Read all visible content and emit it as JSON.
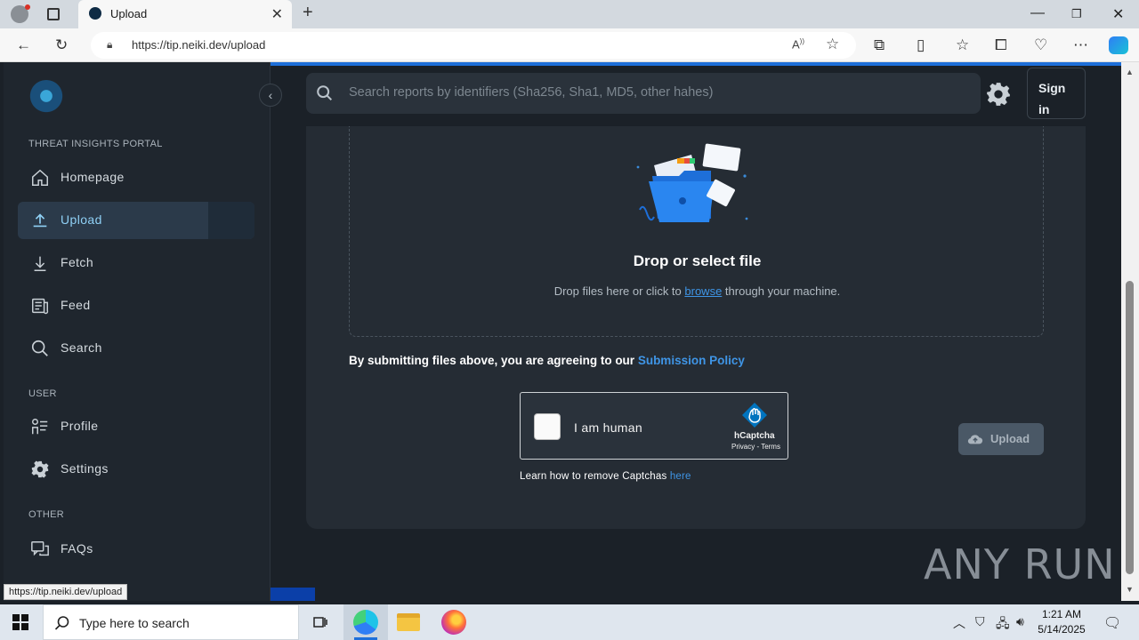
{
  "browser": {
    "tab_title": "Upload",
    "url_full": "https://tip.neiki.dev/upload",
    "url_prefix": "https://",
    "url_host": "tip.neiki.dev",
    "url_path": "/upload",
    "status_url": "https://tip.neiki.dev/upload"
  },
  "sidebar": {
    "portal_label": "THREAT INSIGHTS PORTAL",
    "user_label": "USER",
    "other_label": "OTHER",
    "items": [
      {
        "label": "Homepage",
        "icon": "home-icon"
      },
      {
        "label": "Upload",
        "icon": "upload-icon",
        "active": true
      },
      {
        "label": "Fetch",
        "icon": "download-icon"
      },
      {
        "label": "Feed",
        "icon": "feed-icon"
      },
      {
        "label": "Search",
        "icon": "search-icon"
      },
      {
        "label": "Profile",
        "icon": "profile-icon"
      },
      {
        "label": "Settings",
        "icon": "gear-icon"
      },
      {
        "label": "FAQs",
        "icon": "faq-icon"
      }
    ]
  },
  "header": {
    "search_placeholder": "Search reports by identifiers (Sha256, Sha1, MD5, other hahes)",
    "signin_label": "Sign in"
  },
  "upload": {
    "drop_title": "Drop or select file",
    "drop_sub_before": "Drop files here or click to ",
    "drop_sub_link": "browse",
    "drop_sub_after": " through your machine.",
    "agree_text": "By submitting files above, you are agreeing to our ",
    "agree_link": "Submission Policy",
    "captcha_label": "I am human",
    "captcha_brand": "hCaptcha",
    "captcha_links": "Privacy - Terms",
    "learn_text": "Learn how to remove Captchas ",
    "learn_link": "here",
    "upload_button": "Upload"
  },
  "watermark": "ANY RUN",
  "taskbar": {
    "search_placeholder": "Type here to search",
    "time": "1:21 AM",
    "date": "5/14/2025"
  },
  "colors": {
    "accent": "#3f95e6",
    "sidebar_bg": "#1f262e",
    "page_bg": "#1b2128",
    "card_bg": "#252c34"
  }
}
